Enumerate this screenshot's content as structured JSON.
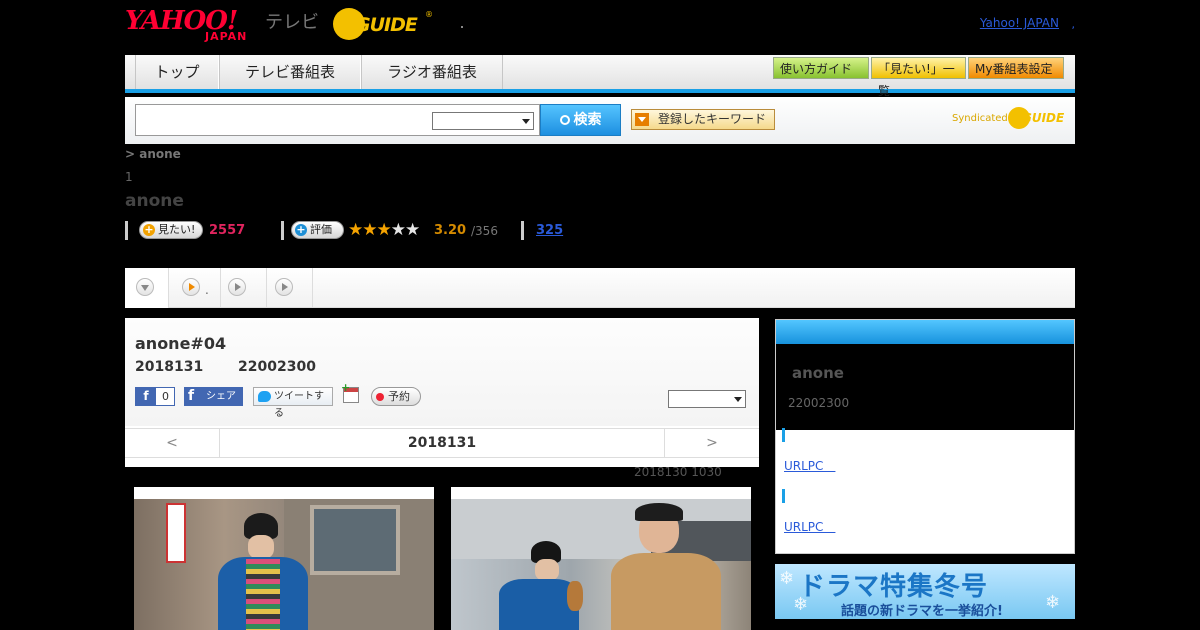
{
  "header": {
    "yahoo_logo": "YAHOO!",
    "yahoo_sub": "JAPAN",
    "tv_label": "テレビ",
    "gguide_logo": "GUIDE",
    "gguide_reg": "®",
    "top_link": "Yahoo! JAPAN",
    "top_link_comma": ","
  },
  "nav": {
    "tabs": [
      "トップ",
      "テレビ番組表",
      "ラジオ番組表"
    ],
    "buttons": [
      "使い方ガイド",
      "「見たい!」一覧",
      "My番組表設定"
    ]
  },
  "search": {
    "input_value": "",
    "button_label": "検索",
    "keyword_button": "登録したキーワード",
    "syndicated_label": "Syndicated",
    "syndicated_logo": "GUIDE"
  },
  "program": {
    "breadcrumb": "> anone",
    "index": "1",
    "title": "anone",
    "mitai_label": "見たい!",
    "mitai_count": "2557",
    "hyouka_label": "評価",
    "rating": "3.20",
    "rating_count": "/356",
    "stars_on": "★★★",
    "stars_off": "★★",
    "review_link": "325"
  },
  "tabs": {
    "dot": "."
  },
  "episode": {
    "title": "anone#04",
    "date": "2018131",
    "time": "22002300",
    "fb_like_glyph": "f",
    "fb_like_count": "0",
    "fb_share_glyph": "f",
    "fb_share_label": "シェア",
    "tweet_label": "ツイートする",
    "reserve_label": "予約",
    "prev": "<",
    "current_date": "2018131",
    "next": ">",
    "updated": "2018130  1030"
  },
  "sidebar": {
    "title": "anone",
    "time": "22002300",
    "link1": "URLPC　",
    "link2": "URLPC　"
  },
  "banner": {
    "title": "ドラマ特集冬号",
    "subtitle": "話題の新ドラマを一挙紹介!"
  },
  "colors": {
    "accent_blue": "#1aa0e6",
    "red_count": "#e0245e",
    "star": "#f5a300",
    "fb": "#4267b2"
  }
}
